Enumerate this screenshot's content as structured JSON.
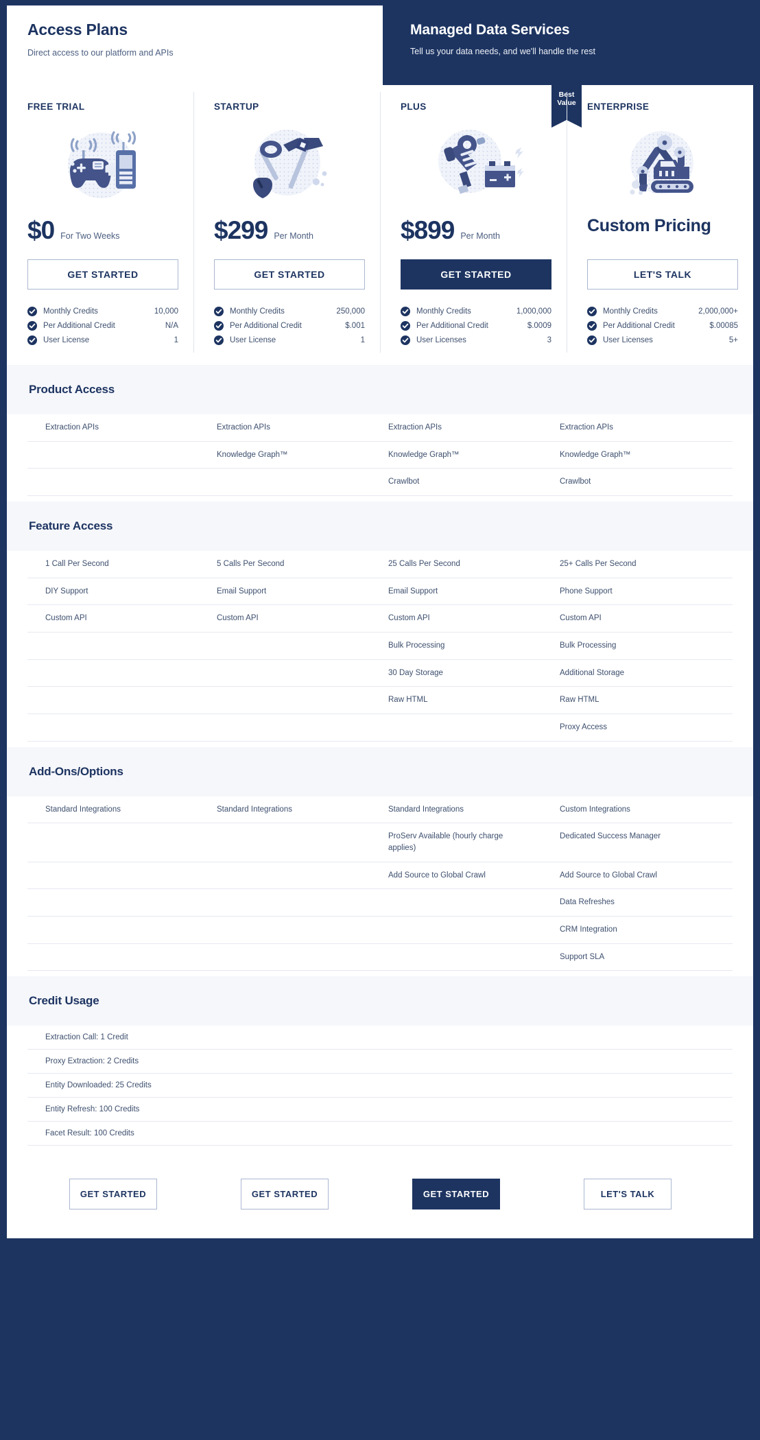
{
  "header": {
    "left_title": "Access Plans",
    "left_subtitle": "Direct access to our platform and APIs",
    "right_title": "Managed Data Services",
    "right_subtitle": "Tell us your data needs, and we'll handle the rest"
  },
  "colors": {
    "navy": "#1d3461",
    "band": "#f6f7fb",
    "text": "#3d4f6e",
    "rule": "#e6e9f1",
    "btn_border": "#aab7d1"
  },
  "ribbon": {
    "line1": "Best",
    "line2": "Value"
  },
  "plans": [
    {
      "name": "FREE TRIAL",
      "icon": "gamepad-radio-icon",
      "price": "$0",
      "price_note": "For Two Weeks",
      "cta": "GET STARTED",
      "cta_style": "outline",
      "specs": [
        {
          "label": "Monthly Credits",
          "value": "10,000"
        },
        {
          "label": "Per Additional Credit",
          "value": "N/A"
        },
        {
          "label": "User License",
          "value": "1"
        }
      ]
    },
    {
      "name": "STARTUP",
      "icon": "shovel-pickaxe-icon",
      "price": "$299",
      "price_note": "Per Month",
      "cta": "GET STARTED",
      "cta_style": "outline",
      "specs": [
        {
          "label": "Monthly Credits",
          "value": "250,000"
        },
        {
          "label": "Per Additional Credit",
          "value": "$.001"
        },
        {
          "label": "User License",
          "value": "1"
        }
      ]
    },
    {
      "name": "PLUS",
      "icon": "jackhammer-battery-icon",
      "price": "$899",
      "price_note": "Per Month",
      "cta": "GET STARTED",
      "cta_style": "solid",
      "specs": [
        {
          "label": "Monthly Credits",
          "value": "1,000,000"
        },
        {
          "label": "Per Additional Credit",
          "value": "$.0009"
        },
        {
          "label": "User Licenses",
          "value": "3"
        }
      ]
    },
    {
      "name": "ENTERPRISE",
      "icon": "excavator-icon",
      "price": "Custom Pricing",
      "price_note": "",
      "cta": "LET'S TALK",
      "cta_style": "outline",
      "specs": [
        {
          "label": "Monthly Credits",
          "value": "2,000,000+"
        },
        {
          "label": "Per Additional Credit",
          "value": "$.00085"
        },
        {
          "label": "User Licenses",
          "value": "5+"
        }
      ]
    }
  ],
  "sections": [
    {
      "title": "Product Access",
      "rows": [
        [
          "Extraction APIs",
          "Extraction APIs",
          "Extraction APIs",
          "Extraction APIs"
        ],
        [
          "",
          "Knowledge Graph™",
          "Knowledge Graph™",
          "Knowledge Graph™"
        ],
        [
          "",
          "",
          "Crawlbot",
          "Crawlbot"
        ]
      ]
    },
    {
      "title": "Feature Access",
      "rows": [
        [
          "1 Call Per Second",
          "5 Calls Per Second",
          "25 Calls Per Second",
          "25+ Calls Per Second"
        ],
        [
          "DIY Support",
          "Email Support",
          "Email Support",
          "Phone Support"
        ],
        [
          "Custom API",
          "Custom API",
          "Custom API",
          "Custom API"
        ],
        [
          "",
          "",
          "Bulk Processing",
          "Bulk Processing"
        ],
        [
          "",
          "",
          "30 Day Storage",
          "Additional Storage"
        ],
        [
          "",
          "",
          "Raw HTML",
          "Raw HTML"
        ],
        [
          "",
          "",
          "",
          "Proxy Access"
        ]
      ]
    },
    {
      "title": "Add-Ons/Options",
      "rows": [
        [
          "Standard Integrations",
          "Standard Integrations",
          "Standard Integrations",
          "Custom Integrations"
        ],
        [
          "",
          "",
          "ProServ Available (hourly charge applies)",
          "Dedicated Success Manager"
        ],
        [
          "",
          "",
          "Add Source to Global Crawl",
          "Add Source to Global Crawl"
        ],
        [
          "",
          "",
          "",
          "Data Refreshes"
        ],
        [
          "",
          "",
          "",
          "CRM Integration"
        ],
        [
          "",
          "",
          "",
          "Support SLA"
        ]
      ]
    }
  ],
  "credit_usage": {
    "title": "Credit Usage",
    "rows": [
      "Extraction Call: 1 Credit",
      "Proxy Extraction: 2 Credits",
      "Entity Downloaded: 25 Credits",
      "Entity Refresh: 100 Credits",
      "Facet Result: 100 Credits"
    ]
  },
  "footer_ctas": [
    {
      "label": "GET STARTED",
      "style": "outline"
    },
    {
      "label": "GET STARTED",
      "style": "outline"
    },
    {
      "label": "GET STARTED",
      "style": "solid"
    },
    {
      "label": "LET'S TALK",
      "style": "outline"
    }
  ]
}
